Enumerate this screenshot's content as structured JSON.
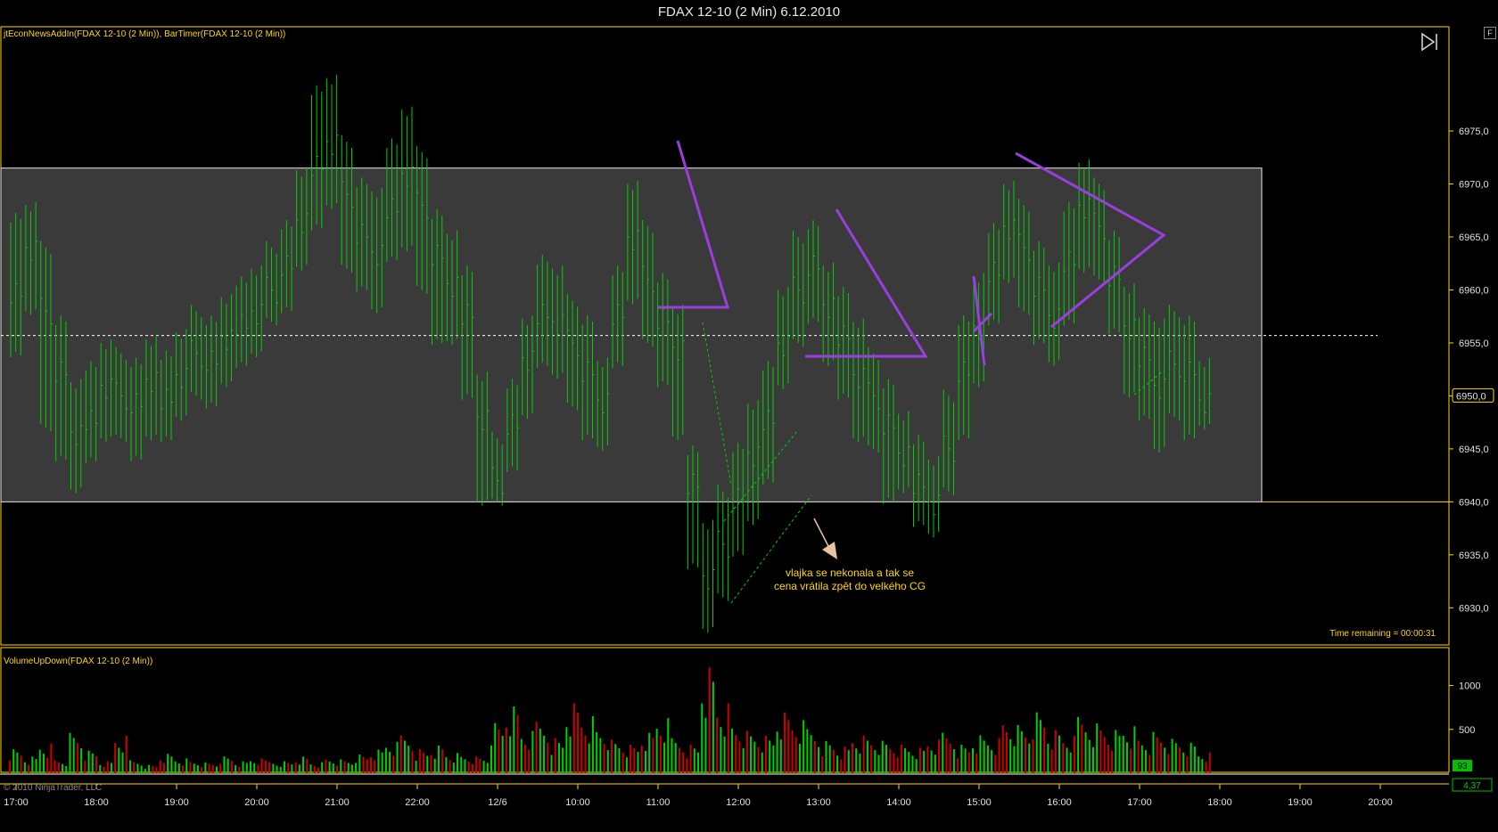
{
  "window": {
    "title": "FDAX 12-10 (2 Min)  6.12.2010",
    "pin_label": "F"
  },
  "price_panel": {
    "indicators_label": "jtEconNewsAddIn(FDAX 12-10 (2 Min)), BarTimer(FDAX 12-10 (2 Min))",
    "time_remaining": "Time remaining = 00:00:31",
    "last_price_label": "6950,0",
    "annotation_lines": [
      "vlajka se nekonala a tak se",
      "cena vrátila zpět do velkého CG"
    ]
  },
  "volume_panel": {
    "label": "VolumeUpDown(FDAX 12-10 (2 Min))",
    "last_volume_label": "93"
  },
  "footer": {
    "copyright": "© 2010 NinjaTrader, LLC",
    "cross_value": "4,37"
  },
  "colors": {
    "frame": "#ffd700",
    "up": "#00d000",
    "down": "#cc0000",
    "pattern": "#9a3ee0",
    "range_box": "#3a3a3a"
  },
  "chart_data": [
    {
      "type": "candlestick-range",
      "title": "",
      "instrument": "FDAX 12-10 (2 Min)",
      "y_ticks": [
        "6975,0",
        "6970,0",
        "6965,0",
        "6960,0",
        "6955,0",
        "6950,0",
        "6945,0",
        "6940,0",
        "6935,0",
        "6930,0"
      ],
      "ylim": [
        6927,
        6984
      ],
      "x_ticks": [
        "17:00",
        "18:00",
        "19:00",
        "20:00",
        "21:00",
        "22:00",
        "12/6",
        "10:00",
        "11:00",
        "12:00",
        "13:00",
        "14:00",
        "15:00",
        "16:00",
        "17:00",
        "18:00",
        "19:00",
        "20:00"
      ],
      "series": [
        {
          "values": [
            6960,
            6964,
            6958,
            6952,
            6946,
            6948,
            6951,
            6950,
            6949,
            6951,
            6950,
            6952,
            6954,
            6953,
            6955,
            6957,
            6958,
            6960,
            6962,
            6966,
            6972,
            6974,
            6969,
            6965,
            6963,
            6968,
            6971,
            6968,
            6963,
            6960,
            6958,
            6948,
            6942,
            6947,
            6953,
            6958,
            6957,
            6955,
            6952,
            6949,
            6958,
            6965,
            6961,
            6957,
            6954,
            6942,
            6933,
            6936,
            6940,
            6944,
            6948,
            6955,
            6960,
            6962,
            6958,
            6956,
            6952,
            6950,
            6947,
            6944,
            6942,
            6940,
            6945,
            6952,
            6956,
            6962,
            6966,
            6964,
            6960,
            6957,
            6963,
            6968,
            6966,
            6961,
            6956,
            6954,
            6951,
            6953,
            6952,
            6949
          ],
          "low": [
            6954,
            6958,
            6947,
            6944,
            6941,
            6944,
            6946,
            6946,
            6944,
            6946,
            6946,
            6948,
            6950,
            6949,
            6951,
            6953,
            6954,
            6957,
            6958,
            6962,
            6966,
            6968,
            6962,
            6960,
            6958,
            6963,
            6964,
            6960,
            6955,
            6955,
            6950,
            6940,
            6940,
            6943,
            6948,
            6953,
            6952,
            6949,
            6946,
            6945,
            6953,
            6959,
            6955,
            6951,
            6946,
            6934,
            6928,
            6931,
            6935,
            6938,
            6942,
            6951,
            6955,
            6957,
            6953,
            6950,
            6946,
            6945,
            6940,
            6941,
            6938,
            6937,
            6941,
            6946,
            6951,
            6957,
            6961,
            6958,
            6955,
            6953,
            6957,
            6962,
            6961,
            6956,
            6950,
            6948,
            6945,
            6948,
            6946,
            6947
          ],
          "high": [
            6967,
            6968,
            6964,
            6957,
            6951,
            6953,
            6955,
            6954,
            6953,
            6955,
            6954,
            6956,
            6958,
            6957,
            6959,
            6961,
            6962,
            6964,
            6966,
            6971,
            6979,
            6980,
            6974,
            6970,
            6969,
            6974,
            6977,
            6973,
            6967,
            6965,
            6962,
            6952,
            6946,
            6951,
            6957,
            6963,
            6962,
            6959,
            6957,
            6953,
            6962,
            6970,
            6966,
            6961,
            6958,
            6945,
            6938,
            6941,
            6945,
            6949,
            6953,
            6960,
            6965,
            6966,
            6962,
            6960,
            6957,
            6954,
            6951,
            6948,
            6946,
            6944,
            6950,
            6957,
            6961,
            6966,
            6970,
            6968,
            6964,
            6962,
            6968,
            6972,
            6970,
            6965,
            6960,
            6958,
            6957,
            6958,
            6957,
            6953
          ]
        }
      ],
      "range_box": {
        "top": 6971.5,
        "bottom": 6940,
        "right_time_label": "18:30"
      },
      "reference_price": 6955.7
    },
    {
      "type": "bar",
      "title": "",
      "y_ticks": [
        "1000",
        "500"
      ],
      "ylim": [
        0,
        1250
      ],
      "series": [
        {
          "values": [
            260,
            180,
            320,
            150,
            410,
            230,
            120,
            380,
            140,
            90,
            210,
            160,
            130,
            110,
            170,
            120,
            150,
            140,
            130,
            180,
            120,
            160,
            140,
            190,
            240,
            320,
            410,
            260,
            300,
            220,
            190,
            170,
            510,
            680,
            430,
            560,
            380,
            760,
            620,
            480,
            340,
            290,
            410,
            560,
            380,
            310,
            1150,
            760,
            520,
            430,
            380,
            620,
            540,
            480,
            350,
            290,
            410,
            380,
            330,
            290,
            260,
            340,
            440,
            310,
            410,
            380,
            560,
            490,
            620,
            440,
            380,
            610,
            540,
            470,
            510,
            380,
            420,
            350,
            310,
            210
          ]
        }
      ]
    }
  ]
}
